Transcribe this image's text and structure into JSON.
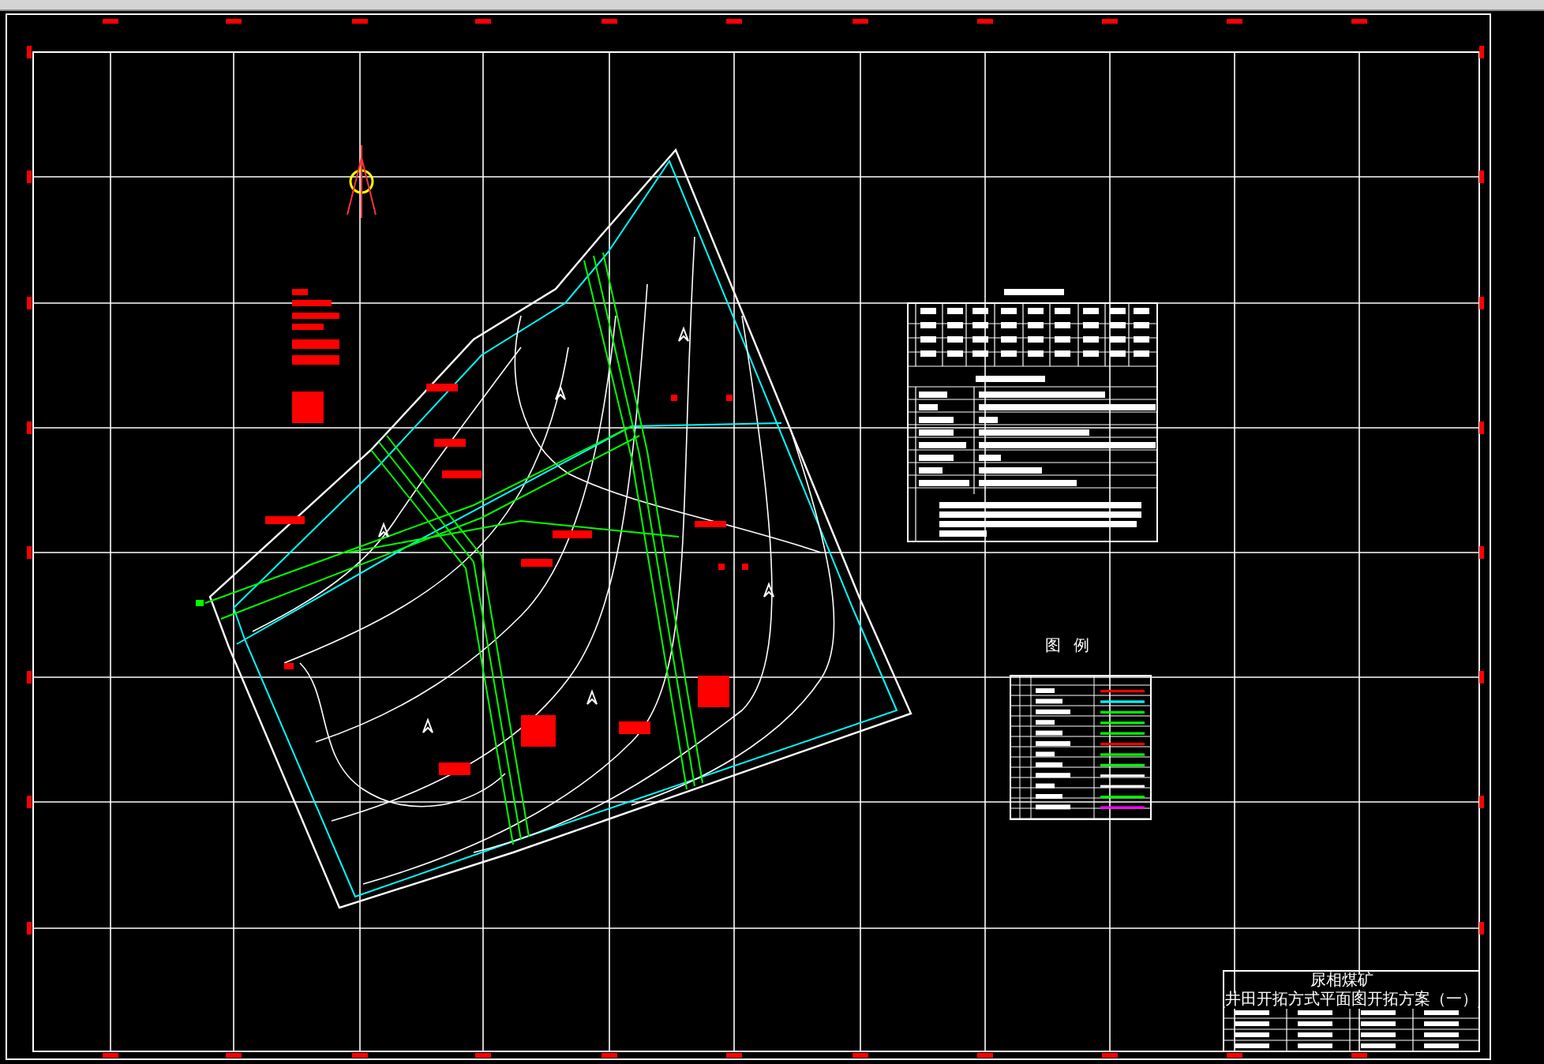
{
  "title_block": {
    "title": "尿相煤矿",
    "subtitle": "井田开拓方式平面图开拓方案（一）"
  },
  "legend": {
    "title": "图例"
  }
}
